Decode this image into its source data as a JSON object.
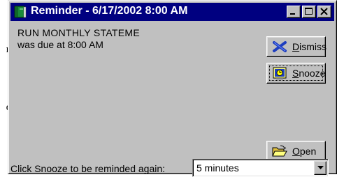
{
  "background_text": [
    "n.",
    "y",
    "e",
    "d",
    "d,",
    "r.",
    "ir"
  ],
  "window": {
    "title": "Reminder - 6/17/2002 8:00 AM",
    "controls": [
      "minimize",
      "maximize",
      "close"
    ]
  },
  "reminder": {
    "subject": "RUN MONTHLY STATEME",
    "due_text": "was due at 8:00 AM"
  },
  "buttons": {
    "dismiss": {
      "mnemonic": "D",
      "rest": "ismiss",
      "icon": "dismiss-x-icon"
    },
    "snooze": {
      "mnemonic": "S",
      "rest": "nooze",
      "icon": "snooze-clock-icon"
    },
    "open": {
      "mnemonic": "O",
      "rest": "pen",
      "icon": "open-folder-icon"
    }
  },
  "snooze": {
    "hint": "Click Snooze to be reminded again:",
    "selected": "5 minutes"
  },
  "colors": {
    "titlebar": "#000080",
    "face": "#c0c0c0",
    "dismiss_icon": "#1f3fbf"
  }
}
